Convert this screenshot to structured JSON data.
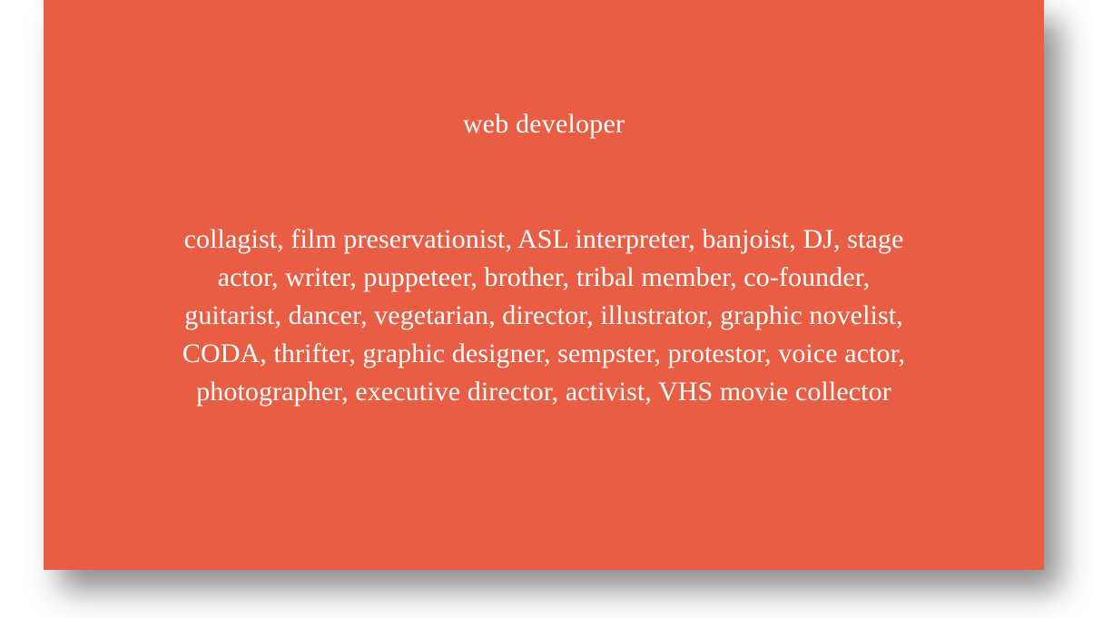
{
  "card": {
    "title": "web developer",
    "roles": "collagist, film preservationist, ASL interpreter, banjoist, DJ, stage actor, writer, puppeteer, brother, tribal member, co-founder, guitarist, dancer, vegetarian, director, illustrator, graphic novelist, CODA, thrifter, graphic designer, sempster, protestor, voice actor, photographer, executive director, activist, VHS movie collector"
  },
  "colors": {
    "card_background": "#e95d44",
    "text": "#ffffff",
    "page_background": "#ffffff"
  }
}
